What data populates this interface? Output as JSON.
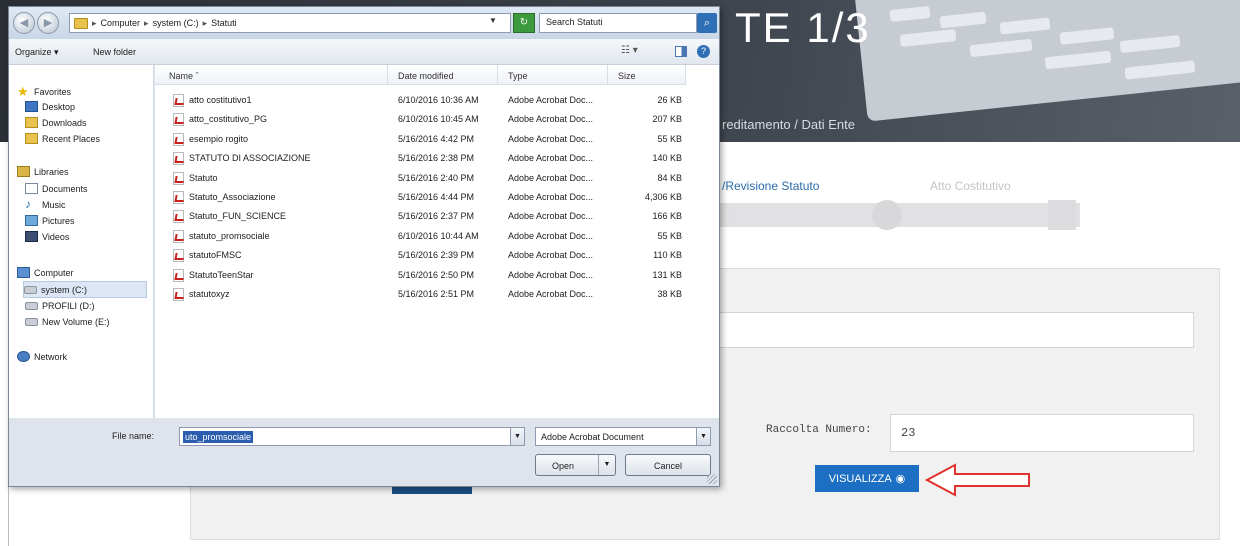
{
  "page": {
    "hero_title": "TE 1/3",
    "breadcrumb": "reditamento  /  Dati Ente",
    "step_active": "/Revisione Statuto",
    "step_next": "Atto Costitutivo",
    "raccolta_label": "Raccolta Numero:",
    "raccolta_value": "23",
    "visualizza_label": "VISUALIZZA"
  },
  "dialog": {
    "address": [
      "Computer",
      "system (C:)",
      "Statuti"
    ],
    "search_placeholder": "Search Statuti",
    "toolbar": {
      "organize": "Organize ▾",
      "new_folder": "New folder"
    },
    "nav": {
      "favorites": "Favorites",
      "desktop": "Desktop",
      "downloads": "Downloads",
      "recent": "Recent Places",
      "libraries": "Libraries",
      "documents": "Documents",
      "music": "Music",
      "pictures": "Pictures",
      "videos": "Videos",
      "computer": "Computer",
      "system": "system (C:)",
      "profili": "PROFILI (D:)",
      "newvol": "New Volume (E:)",
      "network": "Network"
    },
    "columns": {
      "name": "Name",
      "date": "Date modified",
      "type": "Type",
      "size": "Size"
    },
    "files": [
      {
        "name": "atto costitutivo1",
        "date": "6/10/2016 10:36 AM",
        "type": "Adobe Acrobat Doc...",
        "size": "26 KB"
      },
      {
        "name": "atto_costitutivo_PG",
        "date": "6/10/2016 10:45 AM",
        "type": "Adobe Acrobat Doc...",
        "size": "207 KB"
      },
      {
        "name": "esempio rogito",
        "date": "5/16/2016 4:42 PM",
        "type": "Adobe Acrobat Doc...",
        "size": "55 KB"
      },
      {
        "name": "STATUTO DI ASSOCIAZIONE",
        "date": "5/16/2016 2:38 PM",
        "type": "Adobe Acrobat Doc...",
        "size": "140 KB"
      },
      {
        "name": "Statuto",
        "date": "5/16/2016 2:40 PM",
        "type": "Adobe Acrobat Doc...",
        "size": "84 KB"
      },
      {
        "name": "Statuto_Associazione",
        "date": "5/16/2016 4:44 PM",
        "type": "Adobe Acrobat Doc...",
        "size": "4,306 KB"
      },
      {
        "name": "Statuto_FUN_SCIENCE",
        "date": "5/16/2016 2:37 PM",
        "type": "Adobe Acrobat Doc...",
        "size": "166 KB"
      },
      {
        "name": "statuto_promsociale",
        "date": "6/10/2016 10:44 AM",
        "type": "Adobe Acrobat Doc...",
        "size": "55 KB"
      },
      {
        "name": "statutoFMSC",
        "date": "5/16/2016 2:39 PM",
        "type": "Adobe Acrobat Doc...",
        "size": "110 KB"
      },
      {
        "name": "StatutoTeenStar",
        "date": "5/16/2016 2:50 PM",
        "type": "Adobe Acrobat Doc...",
        "size": "131 KB"
      },
      {
        "name": "statutoxyz",
        "date": "5/16/2016 2:51 PM",
        "type": "Adobe Acrobat Doc...",
        "size": "38 KB"
      }
    ],
    "file_name_label": "File name:",
    "file_name_value": "uto_promsociale",
    "file_type": "Adobe Acrobat Document",
    "open_label": "Open",
    "cancel_label": "Cancel"
  },
  "colors": {
    "accent": "#1c6fc2",
    "arrow": "#e0322c",
    "selection": "#2a5dae"
  }
}
